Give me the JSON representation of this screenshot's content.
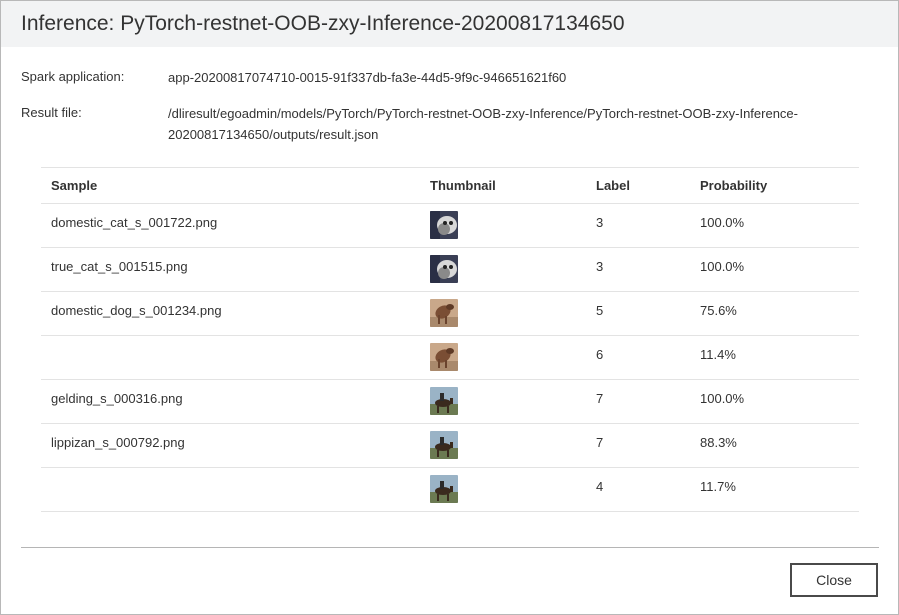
{
  "dialog": {
    "title": "Inference: PyTorch-restnet-OOB-zxy-Inference-20200817134650",
    "spark_application_label": "Spark application:",
    "spark_application_value": "app-20200817074710-0015-91f337db-fa3e-44d5-9f9c-946651621f60",
    "result_file_label": "Result file:",
    "result_file_line1": "/dliresult/egoadmin/models/PyTorch/PyTorch-restnet-OOB-zxy-Inference/PyTorch-restnet-OOB-zxy-Inference-",
    "result_file_line2": "20200817134650/outputs/result.json",
    "close_label": "Close"
  },
  "table": {
    "columns": [
      "Sample",
      "Thumbnail",
      "Label",
      "Probability"
    ],
    "rows": [
      {
        "sample": "domestic_cat_s_001722.png",
        "thumb": "cat-thumbnail",
        "label": "3",
        "probability": "100.0%"
      },
      {
        "sample": "true_cat_s_001515.png",
        "thumb": "cat-thumbnail",
        "label": "3",
        "probability": "100.0%"
      },
      {
        "sample": "domestic_dog_s_001234.png",
        "thumb": "dog-thumbnail",
        "label": "5",
        "probability": "75.6%"
      },
      {
        "sample": "",
        "thumb": "dog-thumbnail",
        "label": "6",
        "probability": "11.4%"
      },
      {
        "sample": "gelding_s_000316.png",
        "thumb": "horse-thumbnail",
        "label": "7",
        "probability": "100.0%"
      },
      {
        "sample": "lippizan_s_000792.png",
        "thumb": "horse-thumbnail",
        "label": "7",
        "probability": "88.3%"
      },
      {
        "sample": "",
        "thumb": "horse-thumbnail",
        "label": "4",
        "probability": "11.7%"
      }
    ]
  },
  "colors": {
    "titlebar": "#f2f3f4",
    "text": "#333333",
    "row_border": "#e3e3e3",
    "button_border": "#4a4a4a"
  }
}
